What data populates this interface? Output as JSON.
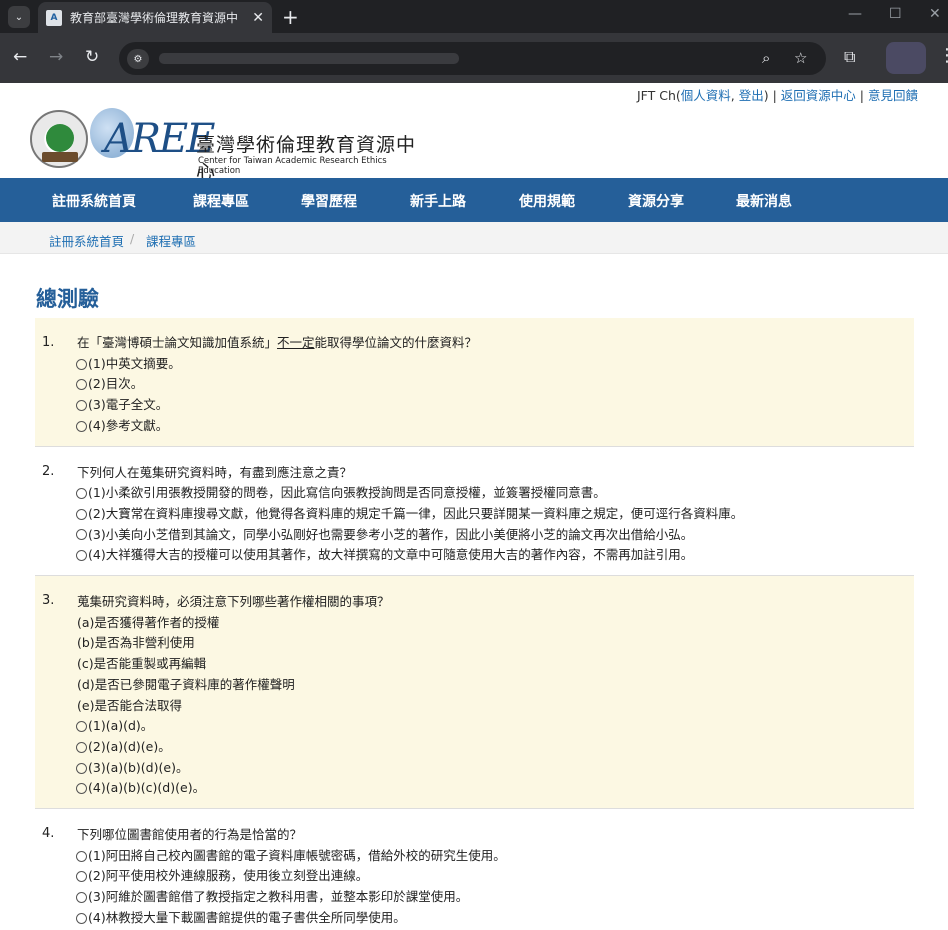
{
  "browser": {
    "tab_title": "教育部臺灣學術倫理教育資源中",
    "tab_close": "✕",
    "new_tab": "+",
    "favicon_text": "A"
  },
  "userbar": {
    "user": "JFT Ch(",
    "profile_link": "個人資料",
    "comma": ", ",
    "logout_link": "登出",
    "close_paren": ")",
    "sep1": " | ",
    "return_link": "返回資源中心",
    "sep2": " | ",
    "feedback_link": "意見回饋"
  },
  "logo": {
    "mark": "AREE",
    "name": "臺灣學術倫理教育資源中心",
    "subtitle": "Center for Taiwan Academic Research Ethics Education"
  },
  "nav": {
    "items": [
      "註冊系統首頁",
      "課程專區",
      "學習歷程",
      "新手上路",
      "使用規範",
      "資源分享",
      "最新消息"
    ]
  },
  "breadcrumb": {
    "items": [
      "註冊系統首頁",
      "課程專區"
    ],
    "sep": "/"
  },
  "page": {
    "title": "總測驗"
  },
  "questions": [
    {
      "num": "1.",
      "stem_before": "在「臺灣博碩士論文知識加值系統」",
      "stem_underline": "不一定",
      "stem_after": "能取得學位論文的什麼資料？",
      "options": [
        "(1)中英文摘要。",
        "(2)目次。",
        "(3)電子全文。",
        "(4)參考文獻。"
      ]
    },
    {
      "num": "2.",
      "stem": "下列何人在蒐集研究資料時，有盡到應注意之責？",
      "options": [
        "(1)小柔欲引用張教授開發的問卷，因此寫信向張教授詢問是否同意授權，並簽署授權同意書。",
        "(2)大寶常在資料庫搜尋文獻，他覺得各資料庫的規定千篇一律，因此只要詳閱某一資料庫之規定，便可逕行各資料庫。",
        "(3)小美向小芝借到其論文，同學小弘剛好也需要參考小芝的著作，因此小美便將小芝的論文再次出借給小弘。",
        "(4)大祥獲得大吉的授權可以使用其著作，故大祥撰寫的文章中可隨意使用大吉的著作內容，不需再加註引用。"
      ]
    },
    {
      "num": "3.",
      "stem": "蒐集研究資料時，必須注意下列哪些著作權相關的事項？",
      "lines": [
        "(a)是否獲得著作者的授權",
        "(b)是否為非營利使用",
        "(c)是否能重製或再編輯",
        "(d)是否已參閱電子資料庫的著作權聲明",
        "(e)是否能合法取得"
      ],
      "options": [
        "(1)(a)(d)。",
        "(2)(a)(d)(e)。",
        "(3)(a)(b)(d)(e)。",
        "(4)(a)(b)(c)(d)(e)。"
      ]
    },
    {
      "num": "4.",
      "stem": "下列哪位圖書館使用者的行為是恰當的？",
      "options": [
        "(1)阿田將自己校內圖書館的電子資料庫帳號密碼，借給外校的研究生使用。",
        "(2)阿平使用校外連線服務，使用後立刻登出連線。",
        "(3)阿維於圖書館借了教授指定之教科用書，並整本影印於課堂使用。",
        "(4)林教授大量下載圖書館提供的電子書供全所同學使用。"
      ]
    }
  ]
}
